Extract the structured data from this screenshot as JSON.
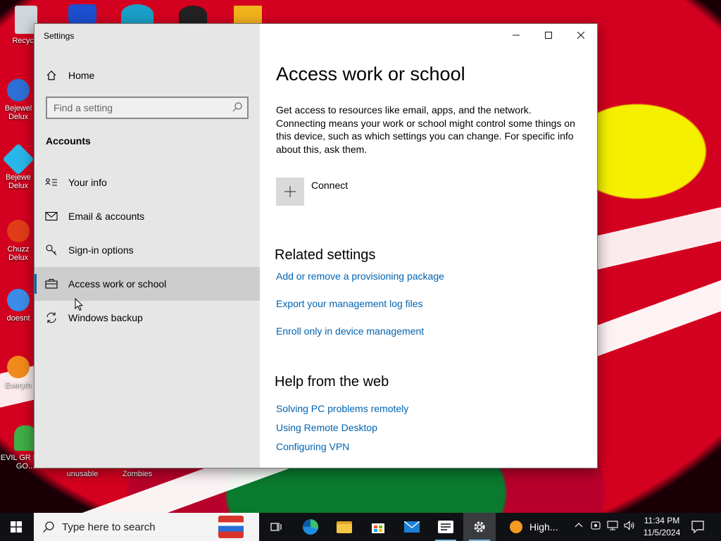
{
  "desktop": {
    "icons": [
      {
        "label": "Recycle"
      },
      {
        "label": "Bejewel Delux"
      },
      {
        "label": "Bejewe Delux"
      },
      {
        "label": "Chuzz Delux"
      },
      {
        "label": "doesnt"
      },
      {
        "label": "Everyth"
      },
      {
        "label": "EVIL GR MEN GO..."
      },
      {
        "label": "unusable"
      },
      {
        "label": "Zombies"
      }
    ]
  },
  "window": {
    "title": "Settings",
    "controls": {
      "minimize": "—",
      "maximize": "☐",
      "close": "✕"
    }
  },
  "sidebar": {
    "home_label": "Home",
    "search_placeholder": "Find a setting",
    "section_heading": "Accounts",
    "items": [
      {
        "label": "Your info",
        "icon": "person-card-icon"
      },
      {
        "label": "Email & accounts",
        "icon": "mail-icon"
      },
      {
        "label": "Sign-in options",
        "icon": "key-icon"
      },
      {
        "label": "Access work or school",
        "icon": "briefcase-icon",
        "selected": true
      },
      {
        "label": "Windows backup",
        "icon": "sync-icon"
      }
    ]
  },
  "main": {
    "title": "Access work or school",
    "description": "Get access to resources like email, apps, and the network. Connecting means your work or school might control some things on this device, such as which settings you can change. For specific info about this, ask them.",
    "connect_label": "Connect",
    "related_title": "Related settings",
    "related_links": [
      "Add or remove a provisioning package",
      "Export your management log files",
      "Enroll only in device management"
    ],
    "help_title": "Help from the web",
    "help_links": [
      "Solving PC problems remotely",
      "Using Remote Desktop",
      "Configuring VPN"
    ]
  },
  "taskbar": {
    "search_placeholder": "Type here to search",
    "high_label": "High...",
    "time": "11:34 PM",
    "date": "11/5/2024"
  },
  "colors": {
    "accent": "#0063b1",
    "sidebar_bg": "#e6e6e6",
    "taskbar_bg": "#101114"
  }
}
